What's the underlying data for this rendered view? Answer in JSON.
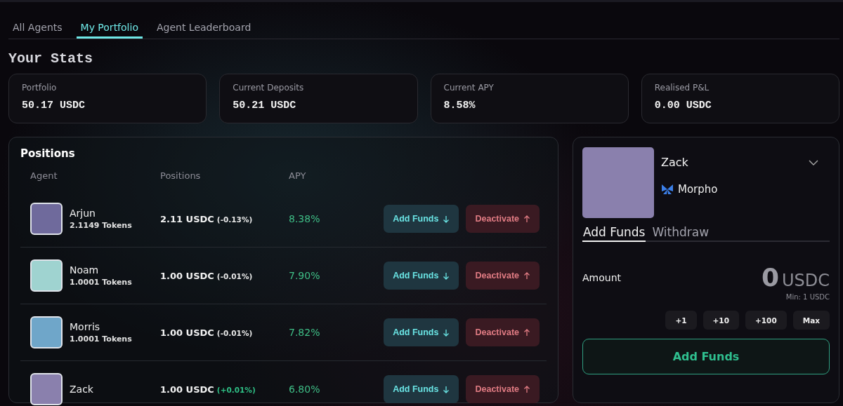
{
  "tabs": [
    {
      "label": "All Agents",
      "selected": false
    },
    {
      "label": "My Portfolio",
      "selected": true
    },
    {
      "label": "Agent Leaderboard",
      "selected": false
    }
  ],
  "stats": {
    "title": "Your Stats",
    "cards": [
      {
        "label": "Portfolio",
        "value": "50.17 USDC"
      },
      {
        "label": "Current Deposits",
        "value": "50.21 USDC"
      },
      {
        "label": "Current APY",
        "value": "8.58%"
      },
      {
        "label": "Realised P&L",
        "value": "0.00 USDC"
      }
    ]
  },
  "positions": {
    "title": "Positions",
    "columns": [
      "Agent",
      "Positions",
      "APY"
    ],
    "rows": [
      {
        "name": "Arjun",
        "tokens": "2.1149 Tokens",
        "color": "#6f6a9c",
        "position": "2.11 USDC",
        "change": "(-0.13%)",
        "positive": false,
        "apy": "8.38%",
        "add_label": "Add Funds",
        "deactivate_label": "Deactivate"
      },
      {
        "name": "Noam",
        "tokens": "1.0001 Tokens",
        "color": "#9fd3d0",
        "position": "1.00 USDC",
        "change": "(-0.01%)",
        "positive": false,
        "apy": "7.90%",
        "add_label": "Add Funds",
        "deactivate_label": "Deactivate"
      },
      {
        "name": "Morris",
        "tokens": "1.0001 Tokens",
        "color": "#6fa6c9",
        "position": "1.00 USDC",
        "change": "(-0.01%)",
        "positive": false,
        "apy": "7.82%",
        "add_label": "Add Funds",
        "deactivate_label": "Deactivate"
      },
      {
        "name": "Zack",
        "color": "#8a80ad",
        "position": "1.00 USDC",
        "change": "(+0.01%)",
        "positive": true,
        "apy": "6.80%",
        "add_label": "Add Funds",
        "deactivate_label": "Deactivate"
      }
    ]
  },
  "agent_panel": {
    "name": "Zack",
    "protocol": "Morpho",
    "tabs": [
      {
        "label": "Add Funds",
        "selected": true
      },
      {
        "label": "Withdraw",
        "selected": false
      }
    ],
    "amount_label": "Amount",
    "amount_value": "0",
    "amount_unit": "USDC",
    "minimum": "Min: 1 USDC",
    "presets": [
      "+1",
      "+10",
      "+100",
      "Max"
    ],
    "submit": "Add Funds"
  }
}
